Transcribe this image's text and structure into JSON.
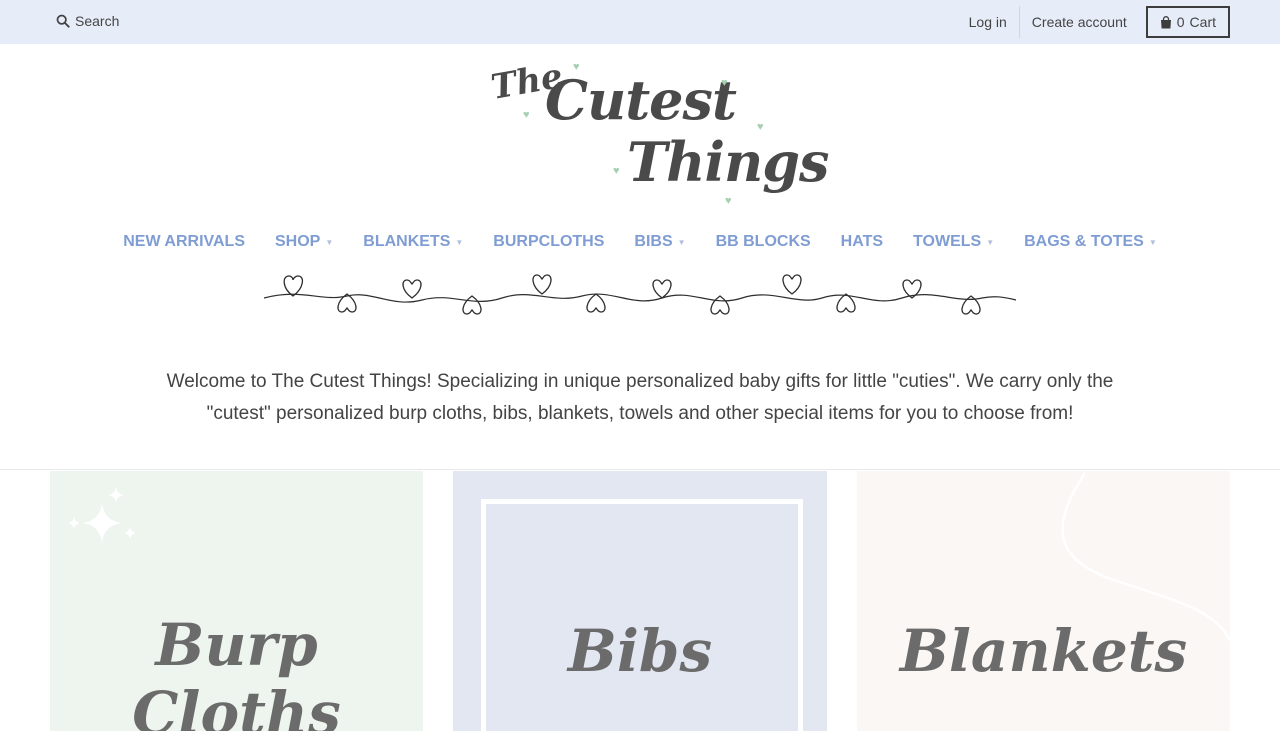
{
  "header": {
    "search_label": "Search",
    "login_label": "Log in",
    "create_account_label": "Create account",
    "cart_count": "0",
    "cart_label": "Cart"
  },
  "logo": {
    "line1": "The",
    "line2": "Cutest",
    "line3": "Things"
  },
  "nav": {
    "items": [
      {
        "label": "NEW ARRIVALS",
        "dropdown": false
      },
      {
        "label": "SHOP",
        "dropdown": true
      },
      {
        "label": "BLANKETS",
        "dropdown": true
      },
      {
        "label": "BURPCLOTHS",
        "dropdown": false
      },
      {
        "label": "BIBS",
        "dropdown": true
      },
      {
        "label": "BB BLOCKS",
        "dropdown": false
      },
      {
        "label": "HATS",
        "dropdown": false
      },
      {
        "label": "TOWELS",
        "dropdown": true
      },
      {
        "label": "BAGS & TOTES",
        "dropdown": true
      }
    ]
  },
  "welcome": {
    "line1": "Welcome to The Cutest Things! Specializing in unique personalized baby gifts for little \"cuties\". We carry only the",
    "line2": "\"cutest\" personalized burp cloths, bibs, blankets, towels and other special items for you to choose from!"
  },
  "collections": [
    {
      "title": "Burp Cloths"
    },
    {
      "title": "Bibs"
    },
    {
      "title": "Blankets"
    }
  ],
  "colors": {
    "topbar_bg": "#e7edf8",
    "nav_text": "#7f9dd3",
    "heart_accent": "#a7cfb1",
    "card_green": "#edf5ee",
    "card_blue": "#e2e7f2",
    "card_cream": "#faf7f4"
  }
}
